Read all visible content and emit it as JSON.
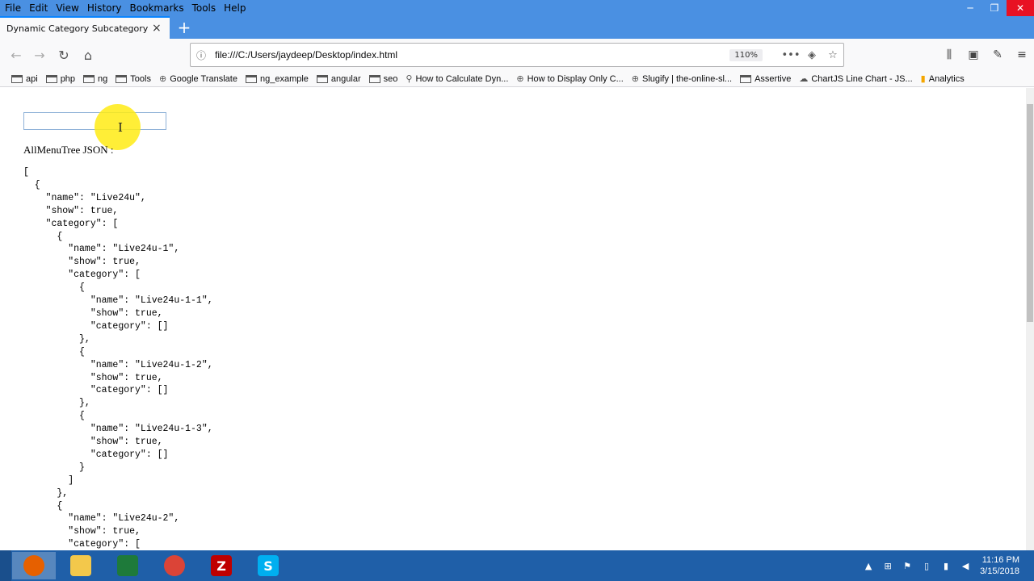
{
  "menu": [
    "File",
    "Edit",
    "View",
    "History",
    "Bookmarks",
    "Tools",
    "Help"
  ],
  "tab": {
    "title": "Dynamic Category Subcategory Tr",
    "close": "×"
  },
  "newtab": "+",
  "url": {
    "text": "file:///C:/Users/jaydeep/Desktop/index.html",
    "zoom": "110%"
  },
  "bookmarks": [
    {
      "label": "api",
      "icon": "folder"
    },
    {
      "label": "php",
      "icon": "folder"
    },
    {
      "label": "ng",
      "icon": "folder"
    },
    {
      "label": "Tools",
      "icon": "folder"
    },
    {
      "label": "Google Translate",
      "icon": "globe"
    },
    {
      "label": "ng_example",
      "icon": "folder"
    },
    {
      "label": "angular",
      "icon": "folder"
    },
    {
      "label": "seo",
      "icon": "folder"
    },
    {
      "label": "How to Calculate Dyn...",
      "icon": "page"
    },
    {
      "label": "How to Display Only C...",
      "icon": "globe"
    },
    {
      "label": "Slugify | the-online-sl...",
      "icon": "globe"
    },
    {
      "label": "Assertive",
      "icon": "folder"
    },
    {
      "label": "ChartJS Line Chart - JS...",
      "icon": "cloud"
    },
    {
      "label": "Analytics",
      "icon": "bars"
    }
  ],
  "page": {
    "search_value": "",
    "json_label": "AllMenuTree JSON :",
    "json_text": "[\n  {\n    \"name\": \"Live24u\",\n    \"show\": true,\n    \"category\": [\n      {\n        \"name\": \"Live24u-1\",\n        \"show\": true,\n        \"category\": [\n          {\n            \"name\": \"Live24u-1-1\",\n            \"show\": true,\n            \"category\": []\n          },\n          {\n            \"name\": \"Live24u-1-2\",\n            \"show\": true,\n            \"category\": []\n          },\n          {\n            \"name\": \"Live24u-1-3\",\n            \"show\": true,\n            \"category\": []\n          }\n        ]\n      },\n      {\n        \"name\": \"Live24u-2\",\n        \"show\": true,\n        \"category\": ["
  },
  "taskbar": {
    "apps": [
      {
        "name": "firefox",
        "glyph": "",
        "color": "#e66000"
      },
      {
        "name": "file-explorer",
        "glyph": "",
        "color": "#f3c84b"
      },
      {
        "name": "spreadsheet",
        "glyph": "",
        "color": "#1e7a3a"
      },
      {
        "name": "chrome",
        "glyph": "",
        "color": "#db4437"
      },
      {
        "name": "filezilla",
        "glyph": "Z",
        "color": "#bf0000"
      },
      {
        "name": "skype",
        "glyph": "S",
        "color": "#00aff0"
      }
    ],
    "time": "11:16 PM",
    "date": "3/15/2018"
  },
  "colors": {
    "titlebar": "#4a90e2",
    "taskbar": "#1f5fa8",
    "highlight": "#ffeb14"
  }
}
